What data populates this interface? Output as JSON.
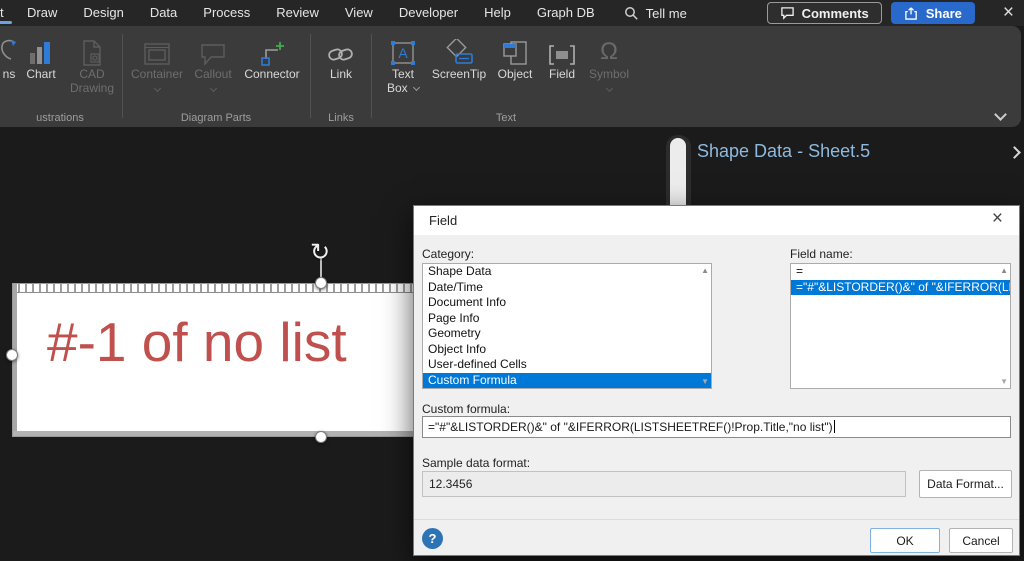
{
  "menu": {
    "partial_tab": "t",
    "items": [
      "Draw",
      "Design",
      "Data",
      "Process",
      "Review",
      "View",
      "Developer",
      "Help",
      "Graph DB"
    ],
    "tell_me": "Tell me",
    "comments": "Comments",
    "share": "Share",
    "close": "×"
  },
  "ribbon": {
    "icons_partial": "ns",
    "chart": "Chart",
    "cad_line1": "CAD",
    "cad_line2": "Drawing",
    "container": "Container",
    "callout": "Callout",
    "connector": "Connector",
    "link": "Link",
    "textbox_line1": "Text",
    "textbox_line2": "Box",
    "screentip": "ScreenTip",
    "object": "Object",
    "field": "Field",
    "symbol": "Symbol",
    "omega_glyph": "Ω",
    "group_illustrations": "ustrations",
    "group_diagram_parts": "Diagram Parts",
    "group_links": "Links",
    "group_text": "Text"
  },
  "canvas": {
    "panel_title": "Shape Data - Sheet.5",
    "shape_text": "#-1 of no list",
    "rotate_glyph": "↻"
  },
  "dialog": {
    "title": "Field",
    "close": "×",
    "category_label": "Category:",
    "categories": [
      "Shape Data",
      "Date/Time",
      "Document Info",
      "Page Info",
      "Geometry",
      "Object Info",
      "User-defined Cells",
      "Custom Formula"
    ],
    "field_name_label": "Field name:",
    "field_names": [
      "=",
      "=\"#\"&LISTORDER()&\" of \"&IFERROR(LISTSHEETREF()!Pr"
    ],
    "custom_formula_label": "Custom formula:",
    "custom_formula_value": "=\"#\"&LISTORDER()&\" of \"&IFERROR(LISTSHEETREF()!Prop.Title,\"no list\")",
    "sample_label": "Sample data format:",
    "sample_value": "12.3456",
    "data_format": "Data Format...",
    "help": "?",
    "ok": "OK",
    "cancel": "Cancel",
    "scroll_up_glyph": "▲",
    "scroll_down_glyph": "▼"
  },
  "colors": {
    "selection_accent": "#0078d7",
    "share_button": "#2969cc",
    "shape_text": "#c0504d",
    "panel_title": "#8fbadf",
    "active_tab_underline": "#6ba3e0"
  }
}
